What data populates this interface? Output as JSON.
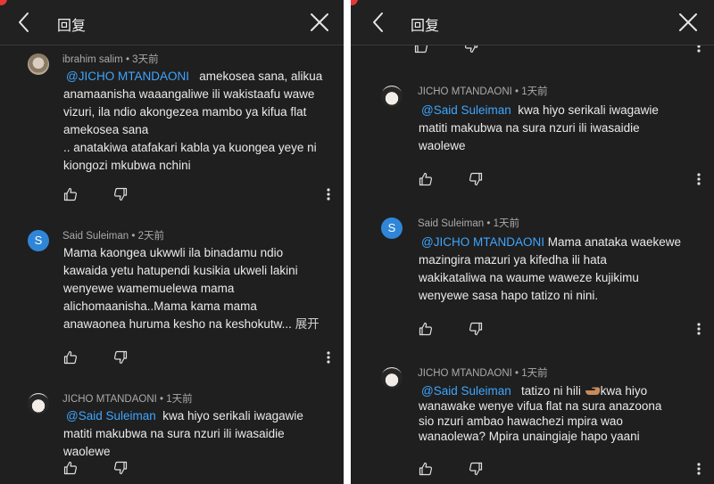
{
  "header": {
    "title": "回复"
  },
  "left": {
    "comments": [
      {
        "author": "ibrahim salim",
        "time": "3天前",
        "mention": "@JICHO MTANDAONI",
        "lines": [
          "amekosea sana, alikua",
          "anamaanisha waaangaliwe ili wakistaafu wawe",
          "vizuri, ila ndio akongezea mambo ya kifua flat",
          "amekosea sana",
          ".. anatakiwa atafakari kabla ya kuongea yeye ni",
          "kiongozi mkubwa nchini"
        ]
      },
      {
        "author": "Said Suleiman",
        "avatar_letter": "S",
        "time": "2天前",
        "lines": [
          "Mama kaongea ukwwli ila binadamu ndio",
          "kawaida yetu hatupendi kusikia ukweli lakini",
          "wenyewe wamemuelewa mama",
          "alichomaanisha..Mama kama mama",
          "anawaonea huruma kesho na keshokutw..."
        ],
        "expand": "展开"
      },
      {
        "author": "JICHO MTANDAONI",
        "time": "1天前",
        "mention": "@Said Suleiman",
        "lines": [
          "kwa hiyo serikali iwagawie",
          "matiti makubwa na sura nzuri ili iwasaidie",
          "waolewe"
        ]
      }
    ]
  },
  "right": {
    "comments": [
      {
        "author": "JICHO MTANDAONI",
        "time": "1天前",
        "mention": "@Said Suleiman",
        "lines": [
          "kwa hiyo serikali iwagawie",
          "matiti makubwa na sura nzuri ili iwasaidie",
          "waolewe"
        ]
      },
      {
        "author": "Said Suleiman",
        "avatar_letter": "S",
        "time": "1天前",
        "mention": "@JICHO MTANDAONI",
        "lines": [
          "Mama anataka waekewe",
          "mazingira mazuri ya kifedha ili hata",
          "wakikataliwa na waume waweze kujikimu",
          "wenyewe sasa hapo tatizo ni nini."
        ]
      },
      {
        "author": "JICHO MTANDAONI",
        "time": "1天前",
        "mention": "@Said Suleiman",
        "lines": [
          "tatizo ni hili",
          "wanawake wenye vifua flat na sura anazoona",
          "sio nzuri ambao hawachezi mpira wao",
          "wanaolewa? Mpira unaingiaje hapo yaani"
        ],
        "line1_tail": "kwa hiyo"
      }
    ]
  },
  "icons": {
    "back": "chevron-left-icon",
    "close": "close-icon",
    "like": "thumb-up-icon",
    "dislike": "thumb-down-icon",
    "more": "more-vert-icon",
    "emoji": "backhand-index-pointing-right-icon"
  },
  "colors": {
    "background": "#1f1f1f",
    "mention": "#3ea6ff",
    "meta": "#aaaaaa",
    "avatar_letter_bg": "#2f86d8"
  }
}
